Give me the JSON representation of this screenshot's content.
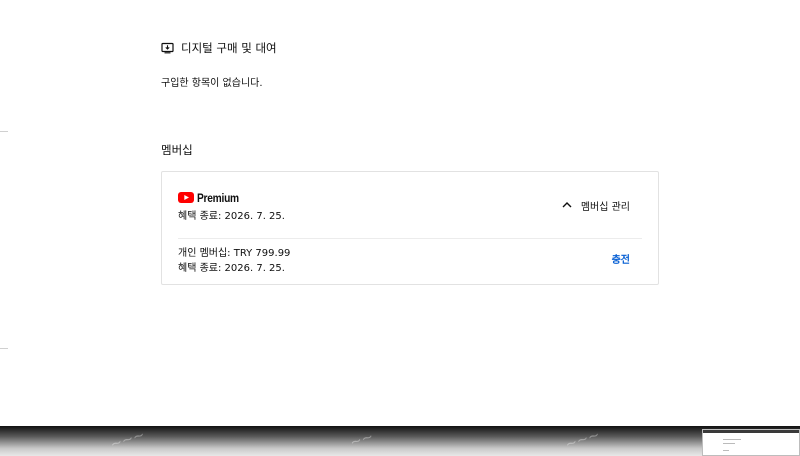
{
  "purchases": {
    "title": "디지털 구매 및 대여",
    "empty_message": "구입한 항목이 없습니다."
  },
  "membership": {
    "heading": "멤버십",
    "card": {
      "brand": "Premium",
      "benefit_end": "혜택 종료: 2026. 7. 25.",
      "manage_label": "멤버십 관리",
      "plan": "개인 멤버십: TRY 799.99",
      "plan_benefit_end": "혜택 종료: 2026. 7. 25.",
      "charge_label": "충전"
    }
  },
  "colors": {
    "brand_red": "#ff0000",
    "link_blue": "#065fd4"
  },
  "icons": {
    "purchases": "purchase-tag-icon",
    "brand": "youtube-play-icon",
    "manage": "chevron-up-icon"
  }
}
